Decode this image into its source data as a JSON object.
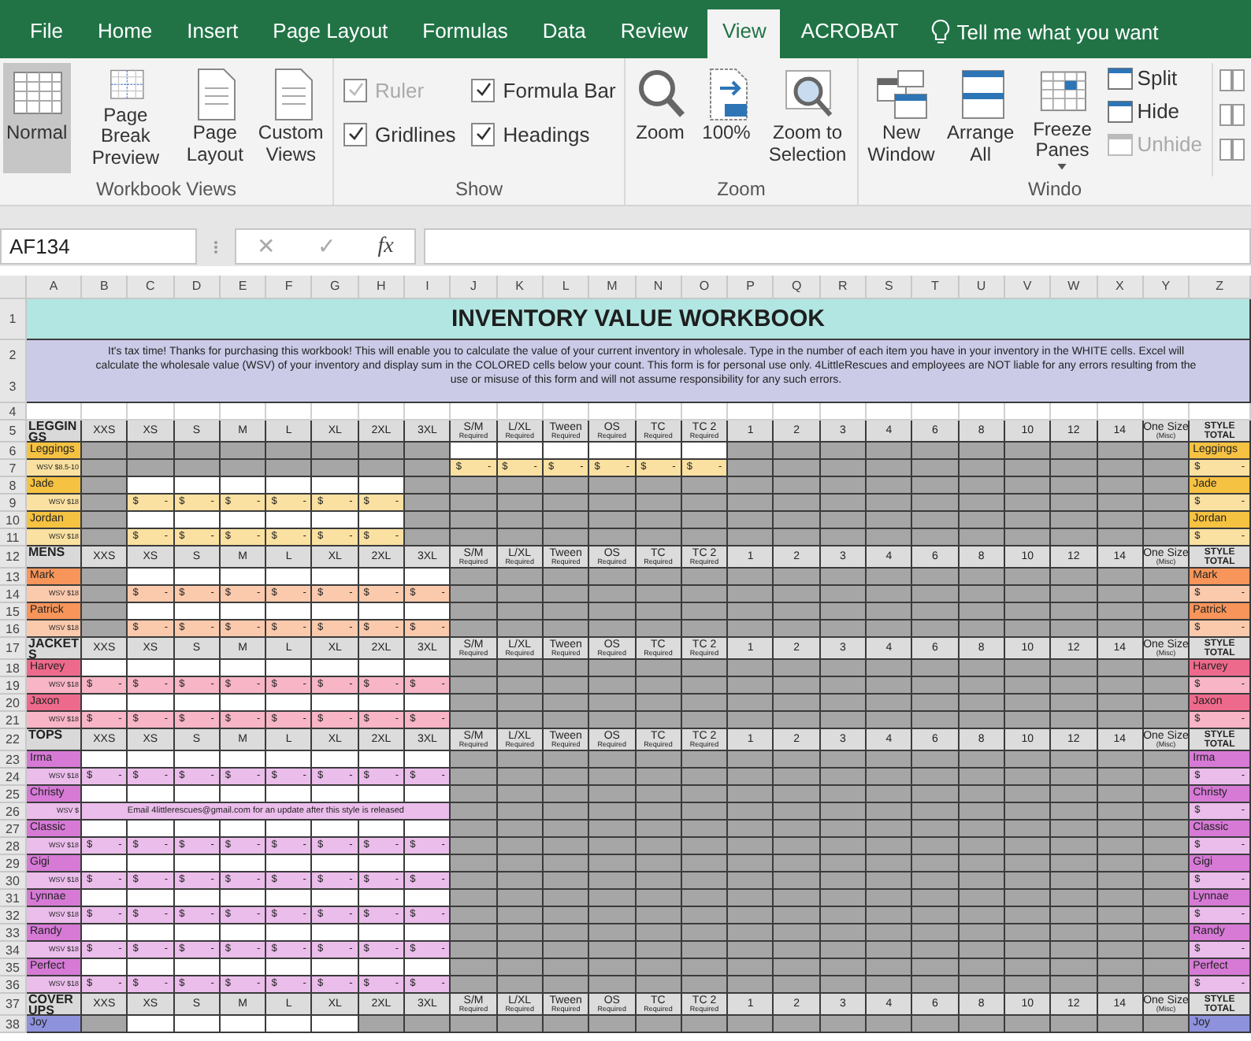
{
  "ribbon_tabs": [
    {
      "label": "File",
      "selected": false
    },
    {
      "label": "Home",
      "selected": false
    },
    {
      "label": "Insert",
      "selected": false
    },
    {
      "label": "Page Layout",
      "selected": false
    },
    {
      "label": "Formulas",
      "selected": false
    },
    {
      "label": "Data",
      "selected": false
    },
    {
      "label": "Review",
      "selected": false
    },
    {
      "label": "View",
      "selected": true
    },
    {
      "label": "ACROBAT",
      "selected": false
    }
  ],
  "tell_me": "Tell me what you want",
  "ribbon_groups": [
    {
      "label": "Workbook Views",
      "items": [
        {
          "kind": "large",
          "label": "Normal",
          "selected": true
        },
        {
          "kind": "large",
          "label": "Page Break Preview",
          "selected": false
        },
        {
          "kind": "large",
          "label": "Page Layout",
          "selected": false
        },
        {
          "kind": "large",
          "label": "Custom Views",
          "selected": false
        }
      ]
    },
    {
      "label": "Show",
      "items": [
        {
          "kind": "check",
          "label": "Ruler",
          "checked": true,
          "disabled": true
        },
        {
          "kind": "check",
          "label": "Formula Bar",
          "checked": true,
          "disabled": false
        },
        {
          "kind": "check",
          "label": "Gridlines",
          "checked": true,
          "disabled": false
        },
        {
          "kind": "check",
          "label": "Headings",
          "checked": true,
          "disabled": false
        }
      ]
    },
    {
      "label": "Zoom",
      "items": [
        {
          "kind": "large",
          "label": "Zoom"
        },
        {
          "kind": "large",
          "label": "100%"
        },
        {
          "kind": "large",
          "label": "Zoom to Selection"
        }
      ]
    },
    {
      "label": "Windo",
      "items": [
        {
          "kind": "large",
          "label": "New Window"
        },
        {
          "kind": "large",
          "label": "Arrange All"
        },
        {
          "kind": "dropdown",
          "label": "Freeze Panes"
        },
        {
          "kind": "small",
          "label": "Split",
          "disabled": false
        },
        {
          "kind": "small",
          "label": "Hide",
          "disabled": false
        },
        {
          "kind": "small",
          "label": "Unhide",
          "disabled": true
        },
        {
          "kind": "icon"
        },
        {
          "kind": "icon"
        },
        {
          "kind": "icon"
        }
      ]
    }
  ],
  "formula_bar": {
    "name_box": "AF134",
    "cancel": "✕",
    "enter": "✓",
    "function": "fx"
  },
  "sheet": {
    "columns": [
      "A",
      "B",
      "C",
      "D",
      "E",
      "F",
      "G",
      "H",
      "I",
      "J",
      "K",
      "L",
      "M",
      "N",
      "O",
      "P",
      "Q",
      "R",
      "S",
      "T",
      "U",
      "V",
      "W",
      "X",
      "Y",
      "Z"
    ],
    "title": {
      "row": "1",
      "text": "INVENTORY VALUE WORKBOOK"
    },
    "intro": {
      "rows": [
        "2",
        "3"
      ],
      "text": "It's tax time! Thanks for purchasing this workbook! This will enable you to calculate the value of your current inventory in wholesale. Type in the number of each item you have in your inventory in the WHITE cells. Excel will calculate the wholesale value (WSV) of your inventory and display sum in the COLORED cells below your count. This form is for personal use only. 4LittleRescues and employees are NOT liable for any errors resulting from the use or misuse of this form and will not assume responsibility for any such errors."
    },
    "spacer_row": "4",
    "sections": [
      {
        "name": "LEGGINGS",
        "row": "5",
        "color": "#f5c242",
        "headers": [
          {
            "label": "XXS"
          },
          {
            "label": "XS"
          },
          {
            "label": "S"
          },
          {
            "label": "M"
          },
          {
            "label": "L"
          },
          {
            "label": "XL"
          },
          {
            "label": "2XL"
          },
          {
            "label": "3XL"
          },
          {
            "label": "S/M",
            "note": "Required"
          },
          {
            "label": "L/XL",
            "note": "Required"
          },
          {
            "label": "Tween",
            "note": "Required"
          },
          {
            "label": "OS",
            "note": "Required"
          },
          {
            "label": "TC",
            "note": "Required"
          },
          {
            "label": "TC 2",
            "note": "Required"
          },
          {
            "label": "1"
          },
          {
            "label": "2"
          },
          {
            "label": "3"
          },
          {
            "label": "4"
          },
          {
            "label": "6"
          },
          {
            "label": "8"
          },
          {
            "label": "10"
          },
          {
            "label": "12"
          },
          {
            "label": "14"
          },
          {
            "label": "One Size",
            "note": "(Misc)"
          },
          {
            "label": "STYLE TOTAL"
          }
        ],
        "styles": [
          {
            "name": "Leggings",
            "row": "6",
            "inputs": [
              false,
              false,
              false,
              false,
              false,
              false,
              false,
              false,
              true,
              true,
              true,
              true,
              true,
              true,
              false,
              false,
              false,
              false,
              false,
              false,
              false,
              false,
              false,
              false
            ],
            "total_name": "Leggings",
            "wsv": {
              "row": "7",
              "label": "WSV $8.5-10",
              "cells": [
                null,
                null,
                null,
                null,
                null,
                null,
                null,
                null,
                "$ -",
                "$ -",
                "$ -",
                "$ -",
                "$ -",
                "$ -",
                null,
                null,
                null,
                null,
                null,
                null,
                null,
                null,
                null,
                null
              ],
              "total": "$ -"
            }
          },
          {
            "name": "Jade",
            "row": "8",
            "inputs": [
              false,
              true,
              true,
              true,
              true,
              true,
              true,
              false,
              false,
              false,
              false,
              false,
              false,
              false,
              false,
              false,
              false,
              false,
              false,
              false,
              false,
              false,
              false,
              false
            ],
            "total_name": "Jade",
            "wsv": {
              "row": "9",
              "label": "WSV $18",
              "cells": [
                null,
                "$ -",
                "$ -",
                "$ -",
                "$ -",
                "$ -",
                "$ -",
                null,
                null,
                null,
                null,
                null,
                null,
                null,
                null,
                null,
                null,
                null,
                null,
                null,
                null,
                null,
                null,
                null
              ],
              "total": "$ -"
            }
          },
          {
            "name": "Jordan",
            "row": "10",
            "inputs": [
              false,
              true,
              true,
              true,
              true,
              true,
              true,
              false,
              false,
              false,
              false,
              false,
              false,
              false,
              false,
              false,
              false,
              false,
              false,
              false,
              false,
              false,
              false,
              false
            ],
            "total_name": "Jordan",
            "wsv": {
              "row": "11",
              "label": "WSV $18",
              "cells": [
                null,
                "$ -",
                "$ -",
                "$ -",
                "$ -",
                "$ -",
                "$ -",
                null,
                null,
                null,
                null,
                null,
                null,
                null,
                null,
                null,
                null,
                null,
                null,
                null,
                null,
                null,
                null,
                null
              ],
              "total": "$ -"
            }
          }
        ]
      },
      {
        "name": "MENS",
        "row": "12",
        "color": "#f7955a",
        "headers": [
          {
            "label": "XXS"
          },
          {
            "label": "XS"
          },
          {
            "label": "S"
          },
          {
            "label": "M"
          },
          {
            "label": "L"
          },
          {
            "label": "XL"
          },
          {
            "label": "2XL"
          },
          {
            "label": "3XL"
          },
          {
            "label": "S/M",
            "note": "Required"
          },
          {
            "label": "L/XL",
            "note": "Required"
          },
          {
            "label": "Tween",
            "note": "Required"
          },
          {
            "label": "OS",
            "note": "Required"
          },
          {
            "label": "TC",
            "note": "Required"
          },
          {
            "label": "TC 2",
            "note": "Required"
          },
          {
            "label": "1"
          },
          {
            "label": "2"
          },
          {
            "label": "3"
          },
          {
            "label": "4"
          },
          {
            "label": "6"
          },
          {
            "label": "8"
          },
          {
            "label": "10"
          },
          {
            "label": "12"
          },
          {
            "label": "14"
          },
          {
            "label": "One Size",
            "note": "(Misc)"
          },
          {
            "label": "STYLE TOTAL"
          }
        ],
        "styles": [
          {
            "name": "Mark",
            "row": "13",
            "inputs": [
              false,
              true,
              true,
              true,
              true,
              true,
              true,
              true,
              false,
              false,
              false,
              false,
              false,
              false,
              false,
              false,
              false,
              false,
              false,
              false,
              false,
              false,
              false,
              false
            ],
            "total_name": "Mark",
            "wsv": {
              "row": "14",
              "label": "WSV $18",
              "cells": [
                null,
                "$ -",
                "$ -",
                "$ -",
                "$ -",
                "$ -",
                "$ -",
                "$ -",
                null,
                null,
                null,
                null,
                null,
                null,
                null,
                null,
                null,
                null,
                null,
                null,
                null,
                null,
                null,
                null
              ],
              "total": "$ -"
            }
          },
          {
            "name": "Patrick",
            "row": "15",
            "inputs": [
              false,
              true,
              true,
              true,
              true,
              true,
              true,
              true,
              false,
              false,
              false,
              false,
              false,
              false,
              false,
              false,
              false,
              false,
              false,
              false,
              false,
              false,
              false,
              false
            ],
            "total_name": "Patrick",
            "wsv": {
              "row": "16",
              "label": "WSV $18",
              "cells": [
                null,
                "$ -",
                "$ -",
                "$ -",
                "$ -",
                "$ -",
                "$ -",
                "$ -",
                null,
                null,
                null,
                null,
                null,
                null,
                null,
                null,
                null,
                null,
                null,
                null,
                null,
                null,
                null,
                null
              ],
              "total": "$ -"
            }
          }
        ]
      },
      {
        "name": "JACKETS",
        "row": "17",
        "color": "#ee6a8c",
        "headers": [
          {
            "label": "XXS"
          },
          {
            "label": "XS"
          },
          {
            "label": "S"
          },
          {
            "label": "M"
          },
          {
            "label": "L"
          },
          {
            "label": "XL"
          },
          {
            "label": "2XL"
          },
          {
            "label": "3XL"
          },
          {
            "label": "S/M",
            "note": "Required"
          },
          {
            "label": "L/XL",
            "note": "Required"
          },
          {
            "label": "Tween",
            "note": "Required"
          },
          {
            "label": "OS",
            "note": "Required"
          },
          {
            "label": "TC",
            "note": "Required"
          },
          {
            "label": "TC 2",
            "note": "Required"
          },
          {
            "label": "1"
          },
          {
            "label": "2"
          },
          {
            "label": "3"
          },
          {
            "label": "4"
          },
          {
            "label": "6"
          },
          {
            "label": "8"
          },
          {
            "label": "10"
          },
          {
            "label": "12"
          },
          {
            "label": "14"
          },
          {
            "label": "One Size",
            "note": "(Misc)"
          },
          {
            "label": "STYLE TOTAL"
          }
        ],
        "styles": [
          {
            "name": "Harvey",
            "row": "18",
            "inputs": [
              true,
              true,
              true,
              true,
              true,
              true,
              true,
              true,
              false,
              false,
              false,
              false,
              false,
              false,
              false,
              false,
              false,
              false,
              false,
              false,
              false,
              false,
              false,
              false
            ],
            "total_name": "Harvey",
            "wsv": {
              "row": "19",
              "label": "WSV $18",
              "cells": [
                "$ -",
                "$ -",
                "$ -",
                "$ -",
                "$ -",
                "$ -",
                "$ -",
                "$ -",
                null,
                null,
                null,
                null,
                null,
                null,
                null,
                null,
                null,
                null,
                null,
                null,
                null,
                null,
                null,
                null
              ],
              "total": "$ -"
            }
          },
          {
            "name": "Jaxon",
            "row": "20",
            "inputs": [
              true,
              true,
              true,
              true,
              true,
              true,
              true,
              true,
              false,
              false,
              false,
              false,
              false,
              false,
              false,
              false,
              false,
              false,
              false,
              false,
              false,
              false,
              false,
              false
            ],
            "total_name": "Jaxon",
            "wsv": {
              "row": "21",
              "label": "WSV $18",
              "cells": [
                "$ -",
                "$ -",
                "$ -",
                "$ -",
                "$ -",
                "$ -",
                "$ -",
                "$ -",
                null,
                null,
                null,
                null,
                null,
                null,
                null,
                null,
                null,
                null,
                null,
                null,
                null,
                null,
                null,
                null
              ],
              "total": "$ -"
            }
          }
        ]
      },
      {
        "name": "TOPS",
        "row": "22",
        "color": "#d67ad6",
        "headers": [
          {
            "label": "XXS"
          },
          {
            "label": "XS"
          },
          {
            "label": "S"
          },
          {
            "label": "M"
          },
          {
            "label": "L"
          },
          {
            "label": "XL"
          },
          {
            "label": "2XL"
          },
          {
            "label": "3XL"
          },
          {
            "label": "S/M",
            "note": "Required"
          },
          {
            "label": "L/XL",
            "note": "Required"
          },
          {
            "label": "Tween",
            "note": "Required"
          },
          {
            "label": "OS",
            "note": "Required"
          },
          {
            "label": "TC",
            "note": "Required"
          },
          {
            "label": "TC 2",
            "note": "Required"
          },
          {
            "label": "1"
          },
          {
            "label": "2"
          },
          {
            "label": "3"
          },
          {
            "label": "4"
          },
          {
            "label": "6"
          },
          {
            "label": "8"
          },
          {
            "label": "10"
          },
          {
            "label": "12"
          },
          {
            "label": "14"
          },
          {
            "label": "One Size",
            "note": "(Misc)"
          },
          {
            "label": "STYLE TOTAL"
          }
        ],
        "styles": [
          {
            "name": "Irma",
            "row": "23",
            "inputs": [
              true,
              true,
              true,
              true,
              true,
              true,
              true,
              true,
              false,
              false,
              false,
              false,
              false,
              false,
              false,
              false,
              false,
              false,
              false,
              false,
              false,
              false,
              false,
              false
            ],
            "total_name": "Irma",
            "wsv": {
              "row": "24",
              "label": "WSV $18",
              "cells": [
                "$ -",
                "$ -",
                "$ -",
                "$ -",
                "$ -",
                "$ -",
                "$ -",
                "$ -",
                null,
                null,
                null,
                null,
                null,
                null,
                null,
                null,
                null,
                null,
                null,
                null,
                null,
                null,
                null,
                null
              ],
              "total": "$ -"
            }
          },
          {
            "name": "Christy",
            "row": "25",
            "inputs": [
              true,
              true,
              true,
              true,
              true,
              true,
              true,
              true,
              false,
              false,
              false,
              false,
              false,
              false,
              false,
              false,
              false,
              false,
              false,
              false,
              false,
              false,
              false,
              false
            ],
            "total_name": "Christy",
            "wsv": {
              "row": "26",
              "label": "WSV $",
              "message": "Email 4littlerescues@gmail.com for an update after this style is released",
              "cells": [
                null,
                null,
                null,
                null,
                null,
                null,
                null,
                null,
                null,
                null,
                null,
                null,
                null,
                null,
                null,
                null
              ],
              "total": "$ -"
            }
          },
          {
            "name": "Classic",
            "row": "27",
            "inputs": [
              true,
              true,
              true,
              true,
              true,
              true,
              true,
              true,
              false,
              false,
              false,
              false,
              false,
              false,
              false,
              false,
              false,
              false,
              false,
              false,
              false,
              false,
              false,
              false
            ],
            "total_name": "Classic",
            "wsv": {
              "row": "28",
              "label": "WSV $18",
              "cells": [
                "$ -",
                "$ -",
                "$ -",
                "$ -",
                "$ -",
                "$ -",
                "$ -",
                "$ -",
                null,
                null,
                null,
                null,
                null,
                null,
                null,
                null,
                null,
                null,
                null,
                null,
                null,
                null,
                null,
                null
              ],
              "total": "$ -"
            }
          },
          {
            "name": "Gigi",
            "row": "29",
            "inputs": [
              true,
              true,
              true,
              true,
              true,
              true,
              true,
              true,
              false,
              false,
              false,
              false,
              false,
              false,
              false,
              false,
              false,
              false,
              false,
              false,
              false,
              false,
              false,
              false
            ],
            "total_name": "Gigi",
            "wsv": {
              "row": "30",
              "label": "WSV $18",
              "cells": [
                "$ -",
                "$ -",
                "$ -",
                "$ -",
                "$ -",
                "$ -",
                "$ -",
                "$ -",
                null,
                null,
                null,
                null,
                null,
                null,
                null,
                null,
                null,
                null,
                null,
                null,
                null,
                null,
                null,
                null
              ],
              "total": "$ -"
            }
          },
          {
            "name": "Lynnae",
            "row": "31",
            "inputs": [
              true,
              true,
              true,
              true,
              true,
              true,
              true,
              true,
              false,
              false,
              false,
              false,
              false,
              false,
              false,
              false,
              false,
              false,
              false,
              false,
              false,
              false,
              false,
              false
            ],
            "total_name": "Lynnae",
            "wsv": {
              "row": "32",
              "label": "WSV $18",
              "cells": [
                "$ -",
                "$ -",
                "$ -",
                "$ -",
                "$ -",
                "$ -",
                "$ -",
                "$ -",
                null,
                null,
                null,
                null,
                null,
                null,
                null,
                null,
                null,
                null,
                null,
                null,
                null,
                null,
                null,
                null
              ],
              "total": "$ -"
            }
          },
          {
            "name": "Randy",
            "row": "33",
            "inputs": [
              true,
              true,
              true,
              true,
              true,
              true,
              true,
              true,
              false,
              false,
              false,
              false,
              false,
              false,
              false,
              false,
              false,
              false,
              false,
              false,
              false,
              false,
              false,
              false
            ],
            "total_name": "Randy",
            "wsv": {
              "row": "34",
              "label": "WSV $18",
              "cells": [
                "$ -",
                "$ -",
                "$ -",
                "$ -",
                "$ -",
                "$ -",
                "$ -",
                "$ -",
                null,
                null,
                null,
                null,
                null,
                null,
                null,
                null,
                null,
                null,
                null,
                null,
                null,
                null,
                null,
                null
              ],
              "total": "$ -"
            }
          },
          {
            "name": "Perfect",
            "row": "35",
            "inputs": [
              true,
              true,
              true,
              true,
              true,
              true,
              true,
              true,
              false,
              false,
              false,
              false,
              false,
              false,
              false,
              false,
              false,
              false,
              false,
              false,
              false,
              false,
              false,
              false
            ],
            "total_name": "Perfect",
            "wsv": {
              "row": "36",
              "label": "WSV $18",
              "cells": [
                "$ -",
                "$ -",
                "$ -",
                "$ -",
                "$ -",
                "$ -",
                "$ -",
                "$ -",
                null,
                null,
                null,
                null,
                null,
                null,
                null,
                null,
                null,
                null,
                null,
                null,
                null,
                null,
                null,
                null
              ],
              "total": "$ -"
            }
          }
        ]
      },
      {
        "name": "COVER UPS",
        "row": "37",
        "color": "#8e92dc",
        "headers": [
          {
            "label": "XXS"
          },
          {
            "label": "XS"
          },
          {
            "label": "S"
          },
          {
            "label": "M"
          },
          {
            "label": "L"
          },
          {
            "label": "XL"
          },
          {
            "label": "2XL"
          },
          {
            "label": "3XL"
          },
          {
            "label": "S/M",
            "note": "Required"
          },
          {
            "label": "L/XL",
            "note": "Required"
          },
          {
            "label": "Tween",
            "note": "Required"
          },
          {
            "label": "OS",
            "note": "Required"
          },
          {
            "label": "TC",
            "note": "Required"
          },
          {
            "label": "TC 2",
            "note": "Required"
          },
          {
            "label": "1"
          },
          {
            "label": "2"
          },
          {
            "label": "3"
          },
          {
            "label": "4"
          },
          {
            "label": "6"
          },
          {
            "label": "8"
          },
          {
            "label": "10"
          },
          {
            "label": "12"
          },
          {
            "label": "14"
          },
          {
            "label": "One Size",
            "note": "(Misc)"
          },
          {
            "label": "STYLE TOTAL"
          }
        ],
        "styles": [
          {
            "name": "Joy",
            "row": "38",
            "inputs": [
              false,
              true,
              true,
              true,
              true,
              true,
              false,
              false,
              false,
              false,
              false,
              false,
              false,
              false,
              false,
              false,
              false,
              false,
              false,
              false,
              false,
              false,
              false,
              false
            ],
            "total_name": "Joy"
          }
        ]
      }
    ]
  }
}
